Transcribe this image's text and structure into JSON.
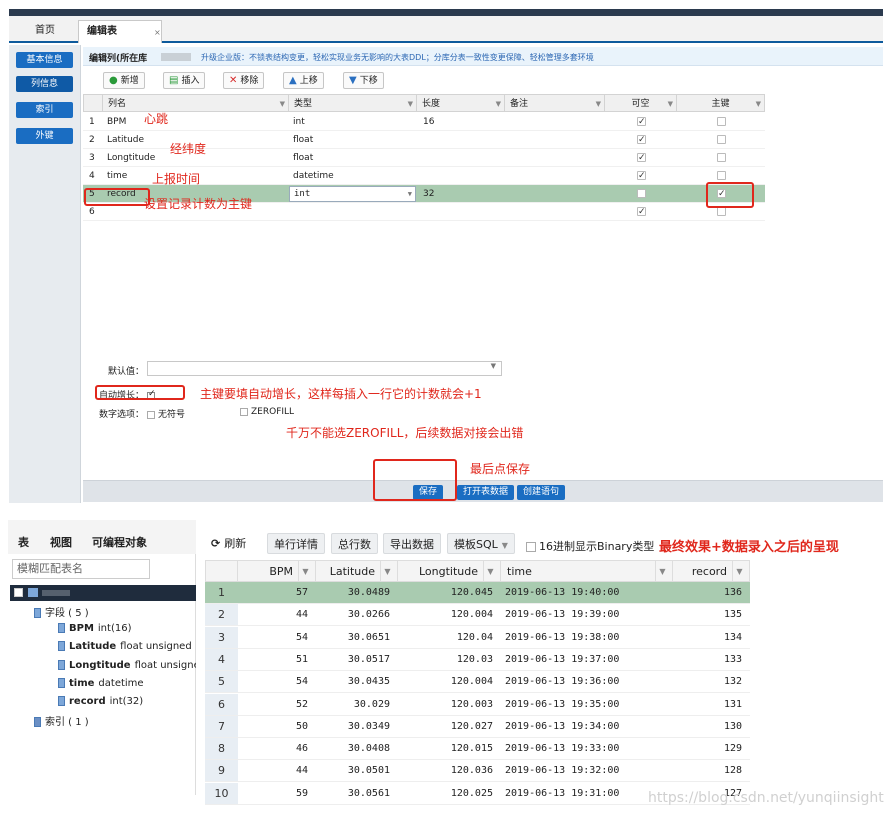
{
  "top": {
    "tabs": {
      "home": "首页",
      "edit": "编辑表",
      "close": "×"
    },
    "sidebar": [
      "基本信息",
      "列信息",
      "索引",
      "外键"
    ],
    "header": {
      "title": "编辑列(所在库",
      "promo": "升级企业版：不锁表结构变更，轻松实现业务无影响的大表DDL；分库分表一致性变更保障、轻松管理多套环境"
    },
    "toolbar": {
      "new": "新增",
      "insert": "插入",
      "remove": "移除",
      "up": "上移",
      "down": "下移"
    },
    "columns": {
      "name": "列名",
      "type": "类型",
      "length": "长度",
      "comment": "备注",
      "nullable": "可空",
      "pk": "主键"
    },
    "rows": [
      {
        "no": "1",
        "name": "BPM",
        "type": "int",
        "length": "16",
        "nullable": true,
        "pk": false
      },
      {
        "no": "2",
        "name": "Latitude",
        "type": "float",
        "length": "",
        "nullable": true,
        "pk": false
      },
      {
        "no": "3",
        "name": "Longtitude",
        "type": "float",
        "length": "",
        "nullable": true,
        "pk": false
      },
      {
        "no": "4",
        "name": "time",
        "type": "datetime",
        "length": "",
        "nullable": true,
        "pk": false
      },
      {
        "no": "5",
        "name": "record",
        "type": "int",
        "length": "32",
        "nullable": false,
        "pk": true
      },
      {
        "no": "6",
        "name": "",
        "type": "",
        "length": "",
        "nullable": true,
        "pk": false
      }
    ],
    "form": {
      "default_label": "默认值：",
      "auto_inc_label": "自动增长：",
      "numeric_label": "数字选项：",
      "unsigned": "无符号",
      "zerofill": "ZEROFILL"
    },
    "bottom": {
      "save": "保存",
      "open_data": "打开表数据",
      "create_sql": "创建语句"
    },
    "notes": {
      "bpm": "心跳",
      "latlng": "经纬度",
      "time": "上报时间",
      "record": "设置记录计数为主键",
      "auto_inc": "主键要填自动增长，这样每插入一行它的计数就会+1",
      "zerofill": "千万不能选ZEROFILL，后续数据对接会出错",
      "save": "最后点保存"
    }
  },
  "bottom": {
    "left_tabs": {
      "table": "表",
      "view": "视图",
      "programmable": "可编程对象"
    },
    "filter_placeholder": "模糊匹配表名",
    "tree": {
      "fields": "字段 ( 5 )",
      "indexes": "索引 ( 1 )",
      "items": [
        {
          "name": "BPM",
          "type": "int(16)"
        },
        {
          "name": "Latitude",
          "type": "float unsigned"
        },
        {
          "name": "Longtitude",
          "type": "float unsigned"
        },
        {
          "name": "time",
          "type": "datetime"
        },
        {
          "name": "record",
          "type": "int(32)"
        }
      ]
    },
    "toolbar": {
      "refresh": "刷新",
      "row_detail": "单行详情",
      "total_rows": "总行数",
      "export": "导出数据",
      "template_sql": "模板SQL",
      "hex": "16进制显示Binary类型"
    },
    "note": "最终效果+数据录入之后的呈现",
    "headers": {
      "bpm": "BPM",
      "lat": "Latitude",
      "lng": "Longtitude",
      "time": "time",
      "record": "record"
    },
    "rows": [
      {
        "n": "1",
        "bpm": "57",
        "lat": "30.0489",
        "lng": "120.045",
        "time": "2019-06-13 19:40:00",
        "record": "136"
      },
      {
        "n": "2",
        "bpm": "44",
        "lat": "30.0266",
        "lng": "120.004",
        "time": "2019-06-13 19:39:00",
        "record": "135"
      },
      {
        "n": "3",
        "bpm": "54",
        "lat": "30.0651",
        "lng": "120.04",
        "time": "2019-06-13 19:38:00",
        "record": "134"
      },
      {
        "n": "4",
        "bpm": "51",
        "lat": "30.0517",
        "lng": "120.03",
        "time": "2019-06-13 19:37:00",
        "record": "133"
      },
      {
        "n": "5",
        "bpm": "54",
        "lat": "30.0435",
        "lng": "120.004",
        "time": "2019-06-13 19:36:00",
        "record": "132"
      },
      {
        "n": "6",
        "bpm": "52",
        "lat": "30.029",
        "lng": "120.003",
        "time": "2019-06-13 19:35:00",
        "record": "131"
      },
      {
        "n": "7",
        "bpm": "50",
        "lat": "30.0349",
        "lng": "120.027",
        "time": "2019-06-13 19:34:00",
        "record": "130"
      },
      {
        "n": "8",
        "bpm": "46",
        "lat": "30.0408",
        "lng": "120.015",
        "time": "2019-06-13 19:33:00",
        "record": "129"
      },
      {
        "n": "9",
        "bpm": "44",
        "lat": "30.0501",
        "lng": "120.036",
        "time": "2019-06-13 19:32:00",
        "record": "128"
      },
      {
        "n": "10",
        "bpm": "59",
        "lat": "30.0561",
        "lng": "120.025",
        "time": "2019-06-13 19:31:00",
        "record": "127"
      }
    ]
  },
  "watermark": "https://blog.csdn.net/yunqiinsight"
}
